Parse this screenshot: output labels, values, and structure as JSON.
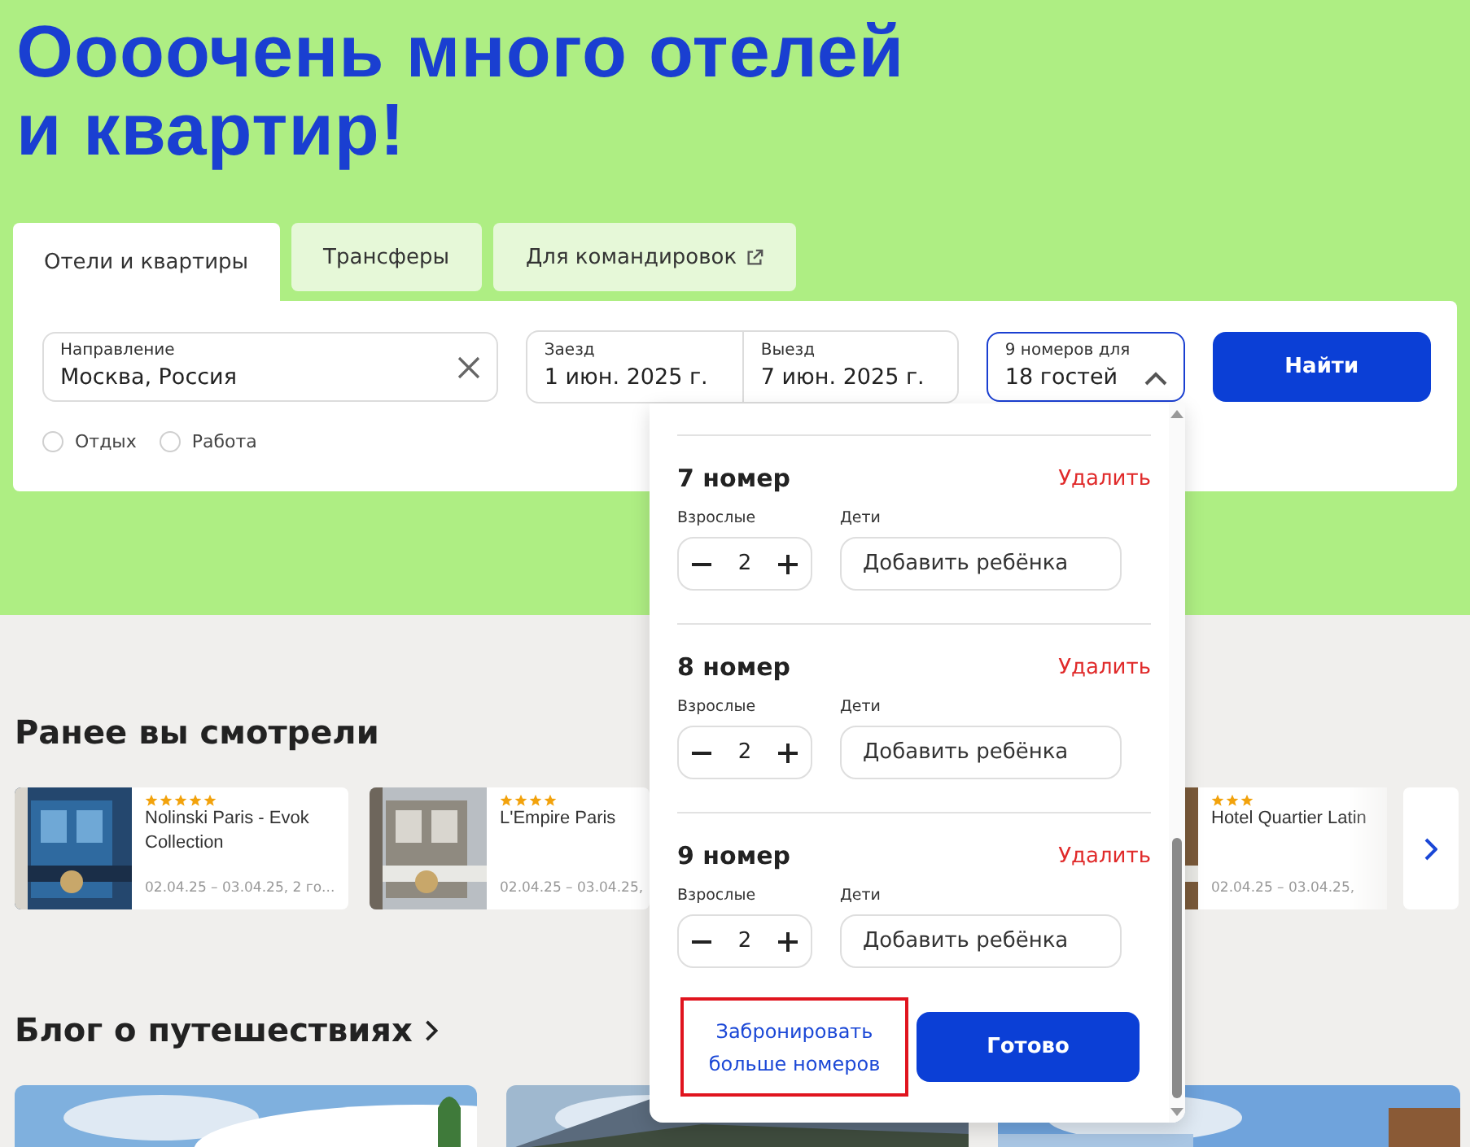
{
  "hero": {
    "title_line1": "Оооочень много отелей",
    "title_line2": "и квартир!"
  },
  "tabs": [
    {
      "label": "Отели и квартиры",
      "selected": true,
      "external": false
    },
    {
      "label": "Трансферы",
      "selected": false,
      "external": false
    },
    {
      "label": "Для командировок",
      "selected": false,
      "external": true
    }
  ],
  "search": {
    "destination": {
      "label": "Направление",
      "value": "Москва, Россия"
    },
    "checkin": {
      "label": "Заезд",
      "value": "1 июн. 2025 г."
    },
    "checkout": {
      "label": "Выезд",
      "value": "7 июн. 2025 г."
    },
    "guests": {
      "label": "9 номеров для",
      "value": "18 гостей",
      "expanded": true
    },
    "button": "Найти",
    "purpose": [
      {
        "label": "Отдых",
        "selected": false
      },
      {
        "label": "Работа",
        "selected": false
      }
    ]
  },
  "rooms_popup": {
    "rooms": [
      {
        "title": "7 номер",
        "remove": "Удалить",
        "adults_label": "Взрослые",
        "adults": "2",
        "children_label": "Дети",
        "add_child": "Добавить ребёнка"
      },
      {
        "title": "8 номер",
        "remove": "Удалить",
        "adults_label": "Взрослые",
        "adults": "2",
        "children_label": "Дети",
        "add_child": "Добавить ребёнка"
      },
      {
        "title": "9 номер",
        "remove": "Удалить",
        "adults_label": "Взрослые",
        "adults": "2",
        "children_label": "Дети",
        "add_child": "Добавить ребёнка"
      }
    ],
    "more_rooms": {
      "label_line1": "Забронировать",
      "label_line2": "больше номеров",
      "highlighted": true
    },
    "done": "Готово"
  },
  "recently_viewed": {
    "title": "Ранее вы смотрели",
    "cards": [
      {
        "stars": 5,
        "name": "Nolinski Paris - Evok Collection",
        "dates": "02.04.25 – 03.04.25, 2 го..."
      },
      {
        "stars": 4,
        "name": "L'Empire Paris",
        "dates": "02.04.25 – 03.04.25,"
      },
      {
        "stars": 3,
        "name": "Hotel Quartier Latin",
        "dates": "02.04.25 – 03.04.25,"
      }
    ]
  },
  "blog": {
    "title": "Блог о путешествиях"
  }
}
